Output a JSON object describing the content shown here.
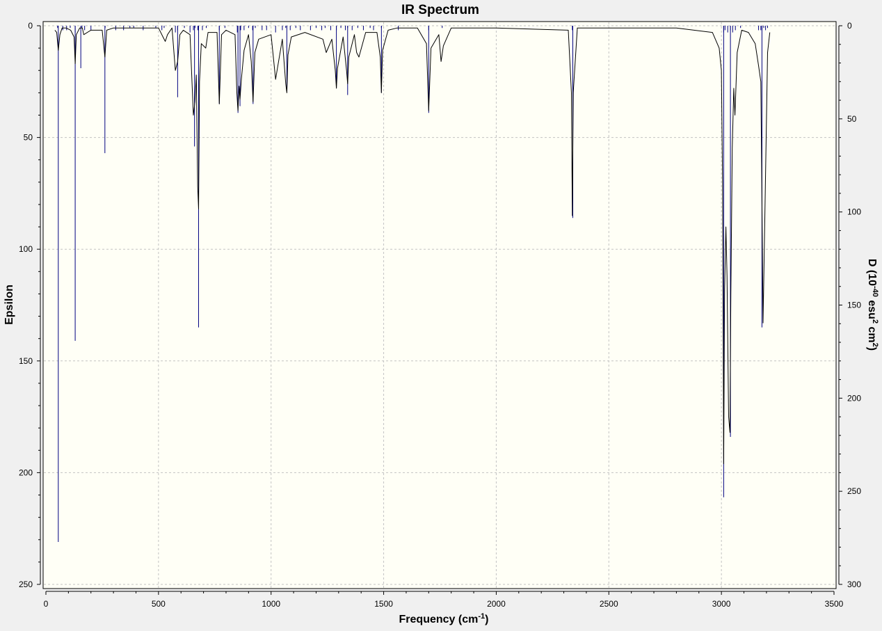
{
  "chart_data": {
    "type": "line",
    "title": "IR Spectrum",
    "xlabel": "Frequency (cm",
    "xlabel_sup": "-1",
    "xlabel_end": ")",
    "ylabel": "Epsilon",
    "y2label_prefix": "D (10",
    "y2label_sup1": "-40",
    "y2label_mid": " esu",
    "y2label_sup2": "2",
    "y2label_mid2": " cm",
    "y2label_sup3": "2",
    "y2label_end": ")",
    "xlim": [
      0,
      3500
    ],
    "ylim": [
      0,
      250
    ],
    "y_inverted": true,
    "y2lim": [
      0,
      300
    ],
    "x_ticks": [
      0,
      500,
      1000,
      1500,
      2000,
      2500,
      3000,
      3500
    ],
    "y_ticks": [
      0,
      50,
      100,
      150,
      200,
      250
    ],
    "y2_ticks": [
      0,
      50,
      100,
      150,
      200,
      250,
      300
    ],
    "grid": true,
    "colors": {
      "plot_bg": "#fffff6",
      "window_bg": "#f0f0f0",
      "grid": "#c2c2c2",
      "spectrum": "#000000",
      "sticks": "#000080"
    },
    "series": [
      {
        "kind": "stick",
        "x": [
          52,
          75,
          92,
          108,
          130,
          160,
          172,
          200,
          263,
          310,
          345,
          373,
          390,
          432,
          488,
          515,
          525,
          575,
          585,
          615,
          640,
          655,
          662,
          675,
          695,
          712,
          770,
          795,
          850,
          865,
          880,
          900,
          918,
          930,
          960,
          980,
          1020,
          1050,
          1065,
          1085,
          1110,
          1130,
          1175,
          1200,
          1225,
          1240,
          1265,
          1290,
          1310,
          1330,
          1340,
          1360,
          1385,
          1410,
          1440,
          1455,
          1490,
          1565,
          1700,
          1760,
          2338,
          3010,
          3016,
          3028,
          3040,
          3050,
          3062,
          3085,
          3165,
          3175,
          3180,
          3188,
          3196,
          3205
        ],
        "values": [
          1,
          2,
          2,
          1,
          3,
          1,
          2,
          2,
          1,
          2,
          2,
          1,
          1,
          2,
          1,
          2,
          1,
          3,
          2,
          1,
          3,
          2,
          1,
          2,
          2,
          1,
          2,
          1,
          3,
          2,
          2,
          1,
          2,
          1,
          2,
          2,
          3,
          2,
          1,
          2,
          1,
          2,
          2,
          1,
          2,
          1,
          2,
          2,
          1,
          2,
          1,
          2,
          1,
          2,
          1,
          2,
          1,
          2,
          2,
          1,
          2,
          3,
          2,
          3,
          2,
          3,
          2,
          1,
          2,
          2,
          2,
          1,
          2,
          1
        ]
      },
      {
        "kind": "stick",
        "x": [
          55,
          130,
          155,
          262,
          585,
          660,
          678,
          770,
          853,
          862,
          920,
          1070,
          1290,
          1340,
          1490,
          1700,
          2340,
          3010,
          3040,
          3180
        ],
        "values": [
          231,
          141,
          19,
          57,
          32,
          54,
          135,
          35,
          39,
          36,
          35,
          29,
          28,
          31,
          30,
          39,
          86,
          211,
          184,
          135
        ]
      },
      {
        "kind": "spectrum",
        "x": [
          40,
          48,
          55,
          62,
          72,
          90,
          110,
          125,
          130,
          135,
          150,
          162,
          168,
          200,
          250,
          262,
          270,
          300,
          340,
          500,
          520,
          530,
          540,
          560,
          575,
          585,
          595,
          610,
          640,
          655,
          662,
          668,
          674,
          678,
          682,
          690,
          710,
          720,
          760,
          770,
          780,
          800,
          840,
          848,
          853,
          858,
          862,
          868,
          880,
          900,
          912,
          920,
          928,
          945,
          1000,
          1020,
          1030,
          1050,
          1065,
          1070,
          1075,
          1090,
          1150,
          1230,
          1245,
          1270,
          1285,
          1290,
          1295,
          1320,
          1335,
          1340,
          1345,
          1370,
          1380,
          1390,
          1420,
          1470,
          1485,
          1490,
          1495,
          1520,
          1560,
          1650,
          1690,
          1700,
          1710,
          1745,
          1755,
          1765,
          1800,
          2000,
          2320,
          2334,
          2338,
          2342,
          2360,
          2600,
          2800,
          2960,
          2990,
          3000,
          3005,
          3010,
          3014,
          3020,
          3025,
          3032,
          3038,
          3042,
          3048,
          3055,
          3060,
          3070,
          3090,
          3120,
          3150,
          3165,
          3175,
          3180,
          3185,
          3195,
          3205,
          3215
        ],
        "values": [
          2,
          3,
          11,
          4,
          1,
          1,
          2,
          5,
          17,
          4,
          1,
          1,
          4,
          2,
          2,
          14,
          2,
          1,
          1,
          1,
          5,
          7,
          4,
          1,
          20,
          16,
          4,
          2,
          4,
          40,
          34,
          22,
          72,
          82,
          25,
          8,
          10,
          3,
          3,
          35,
          4,
          2,
          4,
          30,
          38,
          27,
          33,
          24,
          11,
          4,
          16,
          34,
          12,
          6,
          4,
          24,
          18,
          6,
          26,
          30,
          13,
          5,
          3,
          6,
          12,
          6,
          20,
          28,
          19,
          5,
          20,
          26,
          14,
          4,
          12,
          14,
          3,
          3,
          14,
          30,
          11,
          2,
          1,
          1,
          8,
          38,
          10,
          4,
          16,
          9,
          1,
          1,
          2,
          30,
          85,
          30,
          1,
          1,
          1,
          3,
          10,
          20,
          70,
          196,
          118,
          90,
          112,
          175,
          182,
          120,
          55,
          28,
          40,
          12,
          2,
          3,
          8,
          18,
          25,
          78,
          133,
          72,
          12,
          3
        ]
      }
    ]
  }
}
